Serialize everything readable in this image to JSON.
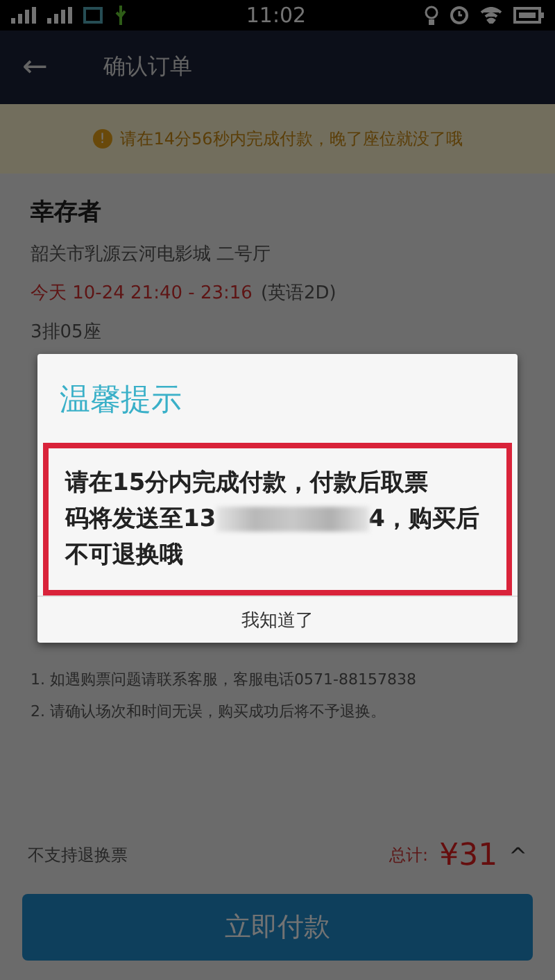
{
  "status_bar": {
    "time": "11:02"
  },
  "app_bar": {
    "back_icon": "←",
    "title": "确认订单"
  },
  "notice": {
    "icon": "!",
    "text": "请在14分56秒内完成付款，晚了座位就没了哦"
  },
  "order": {
    "movie": "幸存者",
    "cinema": "韶关市乳源云河电影城 二号厅",
    "showtime": "今天 10-24 21:40 - 23:16",
    "version": "(英语2D)",
    "seat": "3排05座"
  },
  "notes": [
    "1. 如遇购票问题请联系客服，客服电话0571-88157838",
    "2. 请确认场次和时间无误，购买成功后将不予退换。"
  ],
  "footer": {
    "refund_note": "不支持退换票",
    "total_label": "总计:",
    "total": "¥31",
    "caret": "^",
    "pay_button": "立即付款"
  },
  "dialog": {
    "title": "温馨提示",
    "message": {
      "line_1": "请在15分内完成付款，付款后取票",
      "line_2_before": "码将发送至13",
      "line_2_after": "4，购买后",
      "line_3": "不可退换哦"
    },
    "highlighted": true,
    "button": "我知道了"
  }
}
